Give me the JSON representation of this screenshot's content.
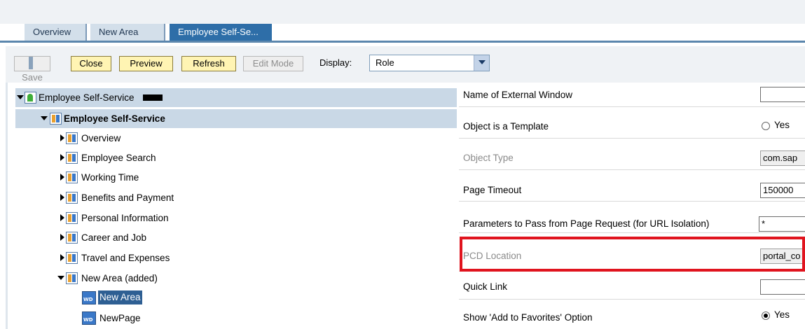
{
  "tabs": [
    {
      "label": "Overview",
      "active": false
    },
    {
      "label": "New Area",
      "active": false
    },
    {
      "label": "Employee Self-Se...",
      "active": true
    }
  ],
  "toolbar": {
    "save": "Save",
    "close": "Close",
    "preview": "Preview",
    "refresh": "Refresh",
    "edit_mode": "Edit Mode",
    "display_label": "Display:",
    "display_value": "Role"
  },
  "tree": {
    "root": "Employee Self-Service",
    "folder": "Employee Self-Service",
    "items": [
      "Overview",
      "Employee Search",
      "Working Time",
      "Benefits and Payment",
      "Personal Information",
      "Career and Job",
      "Travel and Expenses",
      "New Area (added)"
    ],
    "leaves": [
      "New Area",
      "NewPage"
    ]
  },
  "properties": [
    {
      "label": "Name of External Window",
      "value": ""
    },
    {
      "label": "Object is a Template",
      "option": "Yes",
      "checked": false
    },
    {
      "label": "Object Type",
      "value": "com.sap"
    },
    {
      "label": "Page Timeout",
      "value": "150000"
    },
    {
      "label": "Parameters to Pass from Page Request (for URL Isolation)",
      "value": "*"
    },
    {
      "label": "PCD Location",
      "value": "portal_co"
    },
    {
      "label": "Quick Link",
      "value": ""
    },
    {
      "label": "Show 'Add to Favorites' Option",
      "option": "Yes",
      "checked": true
    }
  ],
  "colors": {
    "tab_active": "#2e6ea8",
    "tab_inactive": "#d3dfea",
    "highlight_row": "#c9d8e6",
    "selection": "#2e5f93",
    "annotation_red": "#e0141e",
    "button_yellow": "#fff4b3"
  }
}
